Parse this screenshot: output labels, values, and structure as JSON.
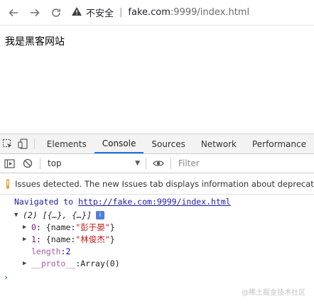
{
  "browser": {
    "security_label": "不安全",
    "url_host": "fake.com",
    "url_path": ":9999/index.html"
  },
  "page": {
    "heading": "我是黑客网站"
  },
  "devtools": {
    "tabs": [
      "Elements",
      "Console",
      "Sources",
      "Network",
      "Performance"
    ],
    "active_tab": "Console",
    "context": "top",
    "filter_placeholder": "Filter",
    "issues_message": "Issues detected. The new Issues tab displays information about deprecation",
    "console": {
      "navigated_prefix": "Navigated to",
      "navigated_url": "http://fake.com:9999/index.html",
      "array_summary": "(2) [{…}, {…}]",
      "items": [
        {
          "index": "0",
          "name_key": "name",
          "name_value": "\"彭于晏\""
        },
        {
          "index": "1",
          "name_key": "name",
          "name_value": "\"林俊杰\""
        }
      ],
      "length_key": "length",
      "length_value": "2",
      "proto_key": "__proto__",
      "proto_value": "Array(0)"
    }
  },
  "watermark": "@稀土掘金技术社区",
  "colors": {
    "accent": "#1a73e8",
    "issue_badge": "#e8a33b",
    "string": "#c41a16",
    "key": "#881280",
    "number": "#1c00cf"
  }
}
